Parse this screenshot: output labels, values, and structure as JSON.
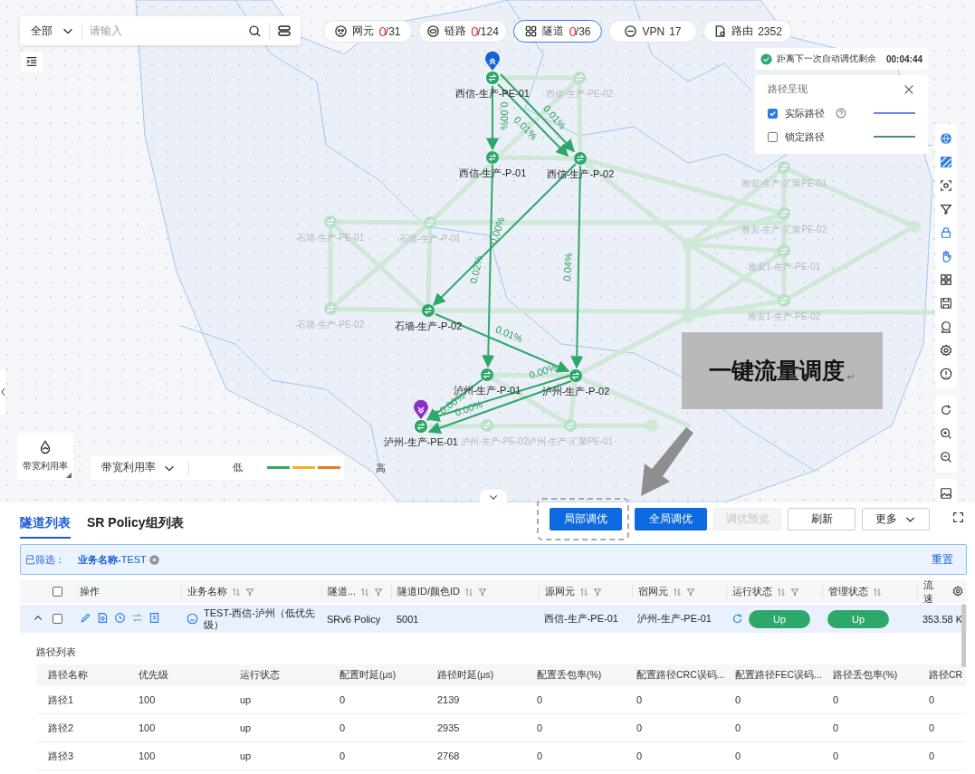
{
  "search": {
    "scope": "全部",
    "placeholder": "请输入"
  },
  "stats": [
    {
      "kind": "alarm",
      "label": "网元",
      "alarm": "0",
      "total": "/31",
      "selected": false
    },
    {
      "kind": "alarm",
      "label": "链路",
      "alarm": "0",
      "total": "/124",
      "selected": false
    },
    {
      "kind": "alarm",
      "label": "隧道",
      "alarm": "0",
      "total": "/36",
      "selected": true
    },
    {
      "kind": "plain",
      "label": "VPN",
      "value": "17",
      "selected": false
    },
    {
      "kind": "plain",
      "label": "路由",
      "value": "2352",
      "selected": false
    }
  ],
  "countdown": {
    "label": "距离下一次自动调优剩余",
    "time": "00:04:44"
  },
  "path_display": {
    "title": "路径呈现",
    "options": [
      {
        "label": "实际路径",
        "checked": true,
        "help": true,
        "color": "#6b7fe3"
      },
      {
        "label": "锁定路径",
        "checked": false,
        "help": false,
        "color": "#4e8a86"
      }
    ]
  },
  "map": {
    "nodes": [
      {
        "label": "西信-生产-PE-01",
        "active": true,
        "start": true,
        "end": false
      },
      {
        "label": "西信-生产-P-01",
        "active": true,
        "start": false,
        "end": false
      },
      {
        "label": "西信-生产-P-02",
        "active": true,
        "start": false,
        "end": false
      },
      {
        "label": "石墙-生产-P-02",
        "active": true,
        "start": false,
        "end": false
      },
      {
        "label": "泸州-生产-P-01",
        "active": true,
        "start": false,
        "end": false
      },
      {
        "label": "泸州-生产-P-02",
        "active": true,
        "start": false,
        "end": false
      },
      {
        "label": "泸州-生产-PE-01",
        "active": true,
        "start": false,
        "end": true
      },
      {
        "label": "西信-生产-PE-02",
        "active": false,
        "start": false,
        "end": false
      },
      {
        "label": "石墙-生产-PE-01",
        "active": false,
        "start": false,
        "end": false
      },
      {
        "label": "石墙-生产-P-01",
        "active": false,
        "start": false,
        "end": false
      },
      {
        "label": "石墙-生产-PE-02",
        "active": false,
        "start": false,
        "end": false
      },
      {
        "label": "泸州-生产-PE-02",
        "active": false,
        "start": false,
        "end": false
      },
      {
        "label": "泸州-生产-汇聚PE-01",
        "active": false,
        "start": false,
        "end": false
      },
      {
        "label": "雅安-生产-汇聚PE-01",
        "active": false,
        "start": false,
        "end": false
      },
      {
        "label": "雅安-生产-汇聚PE-02",
        "active": false,
        "start": false,
        "end": false
      },
      {
        "label": "雅安1-生产-PE-01",
        "active": false,
        "start": false,
        "end": false
      },
      {
        "label": "雅安1-生产-PE-02",
        "active": false,
        "start": false,
        "end": false
      }
    ],
    "links": [
      {
        "label": "0.00%"
      },
      {
        "label": "0.01%"
      },
      {
        "label": "0.01%"
      },
      {
        "label": "0.00%"
      },
      {
        "label": "0.02%"
      },
      {
        "label": "0.04%"
      },
      {
        "label": "0.01%"
      },
      {
        "label": "0.00%"
      },
      {
        "label": "0.00%"
      },
      {
        "label": "0.00%"
      }
    ]
  },
  "metric": {
    "button": "带宽利用率",
    "select": "带宽利用率",
    "low": "低",
    "high": "高",
    "scale": [
      {
        "color": "#2ea86a"
      },
      {
        "color": "#f0b323"
      },
      {
        "color": "#f07a23"
      }
    ]
  },
  "annotation": {
    "text": "一键流量调度",
    "mark": "↵"
  },
  "tabs": [
    {
      "label": "隧道列表",
      "selected": true
    },
    {
      "label": "SR Policy组列表",
      "selected": false
    }
  ],
  "actions": [
    {
      "label": "局部调优",
      "kind": "primary",
      "disabled": false,
      "highlighted": true
    },
    {
      "label": "全局调优",
      "kind": "primary",
      "disabled": false,
      "highlighted": false
    },
    {
      "label": "调优预览",
      "kind": "default",
      "disabled": true,
      "highlighted": false
    },
    {
      "label": "刷新",
      "kind": "default",
      "disabled": false,
      "highlighted": false
    },
    {
      "label": "更多",
      "kind": "menu",
      "disabled": false,
      "highlighted": false
    }
  ],
  "filter": {
    "label": "已筛选：",
    "chips": [
      {
        "text": "**业务名称-**TEST"
      }
    ],
    "reset": "重置"
  },
  "tunnel_table": {
    "header_checked": false,
    "columns": [
      {
        "label": "操作",
        "sortable": false,
        "filterable": false
      },
      {
        "label": "业务名称",
        "sortable": true,
        "filterable": true
      },
      {
        "label": "隧道...",
        "sortable": true,
        "filterable": true
      },
      {
        "label": "隧道ID/颜色ID",
        "sortable": true,
        "filterable": true
      },
      {
        "label": "源网元",
        "sortable": true,
        "filterable": true
      },
      {
        "label": "宿网元",
        "sortable": true,
        "filterable": true
      },
      {
        "label": "运行状态",
        "sortable": true,
        "filterable": true
      },
      {
        "label": "管理状态",
        "sortable": true,
        "filterable": false
      },
      {
        "label": "流速",
        "sortable": false,
        "filterable": false
      }
    ],
    "rows": [
      {
        "expanded": true,
        "checked": false,
        "name": "TEST-西信-泸州（低优先级）",
        "type": "SRv6 Policy",
        "id": "5001",
        "source": "西信-生产-PE-01",
        "sink": "泸州-生产-PE-01",
        "run_state": "Up",
        "admin_state": "Up",
        "rate": "353.58 K"
      }
    ]
  },
  "path_table": {
    "title": "路径列表",
    "columns": [
      "路径名称",
      "优先级",
      "运行状态",
      "配置时延(μs)",
      "路径时延(μs)",
      "配置丢包率(%)",
      "配置路径CRC误码...",
      "配置路径FEC误码...",
      "路径丢包率(%)",
      "路径CR"
    ],
    "rows": [
      [
        "路径1",
        "100",
        "up",
        "0",
        "2139",
        "0",
        "0",
        "0",
        "0",
        "0"
      ],
      [
        "路径2",
        "100",
        "up",
        "0",
        "2935",
        "0",
        "0",
        "0",
        "0",
        "0"
      ],
      [
        "路径3",
        "100",
        "up",
        "0",
        "2768",
        "0",
        "0",
        "0",
        "0",
        "0"
      ]
    ]
  }
}
